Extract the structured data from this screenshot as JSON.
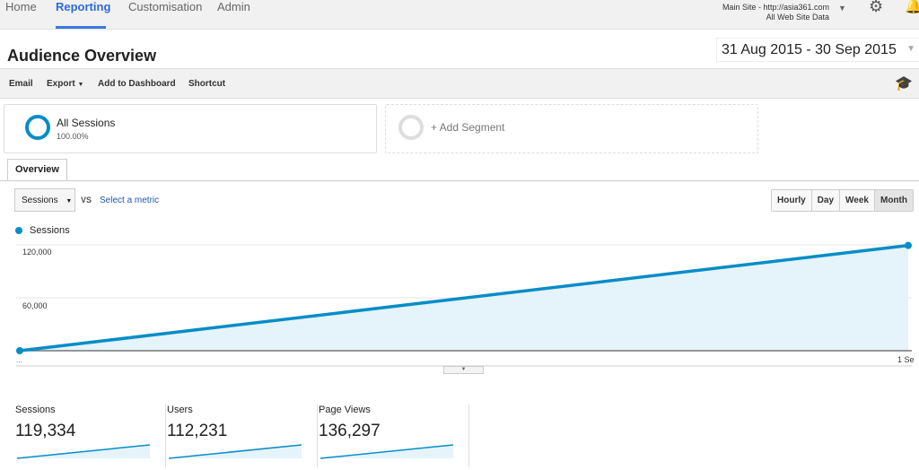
{
  "nav": {
    "items": [
      "Home",
      "Reporting",
      "Customisation",
      "Admin"
    ],
    "active": "Reporting",
    "site": "Main Site - http://asia361.com",
    "view": "All Web Site Data"
  },
  "header": {
    "title": "Audience Overview",
    "date_range": "31 Aug 2015 - 30 Sep 2015"
  },
  "toolbar": {
    "email": "Email",
    "export": "Export",
    "add_to_dashboard": "Add to Dashboard",
    "shortcut": "Shortcut"
  },
  "segments": {
    "all_sessions": "All Sessions",
    "all_sessions_pct": "100.00%",
    "add_segment": "+ Add Segment"
  },
  "tabs": {
    "overview": "Overview"
  },
  "controls": {
    "metric": "Sessions",
    "vs": "VS",
    "select_metric": "Select a metric",
    "granularity": [
      "Hourly",
      "Day",
      "Week",
      "Month"
    ],
    "selected_granularity": "Month"
  },
  "colors": {
    "accent": "#058dc7",
    "fill": "#e5f3fb"
  },
  "chart_data": {
    "type": "area",
    "legend": [
      "Sessions"
    ],
    "x": [
      "...",
      "1 Se"
    ],
    "values": [
      0,
      119334
    ],
    "yticks": [
      "120,000",
      "60,000"
    ],
    "ylim": [
      0,
      120000
    ],
    "grid": true,
    "legend_placement": "top-left"
  },
  "metrics": [
    {
      "label": "Sessions",
      "value": "119,334"
    },
    {
      "label": "Users",
      "value": "112,231"
    },
    {
      "label": "Page Views",
      "value": "136,297"
    }
  ]
}
